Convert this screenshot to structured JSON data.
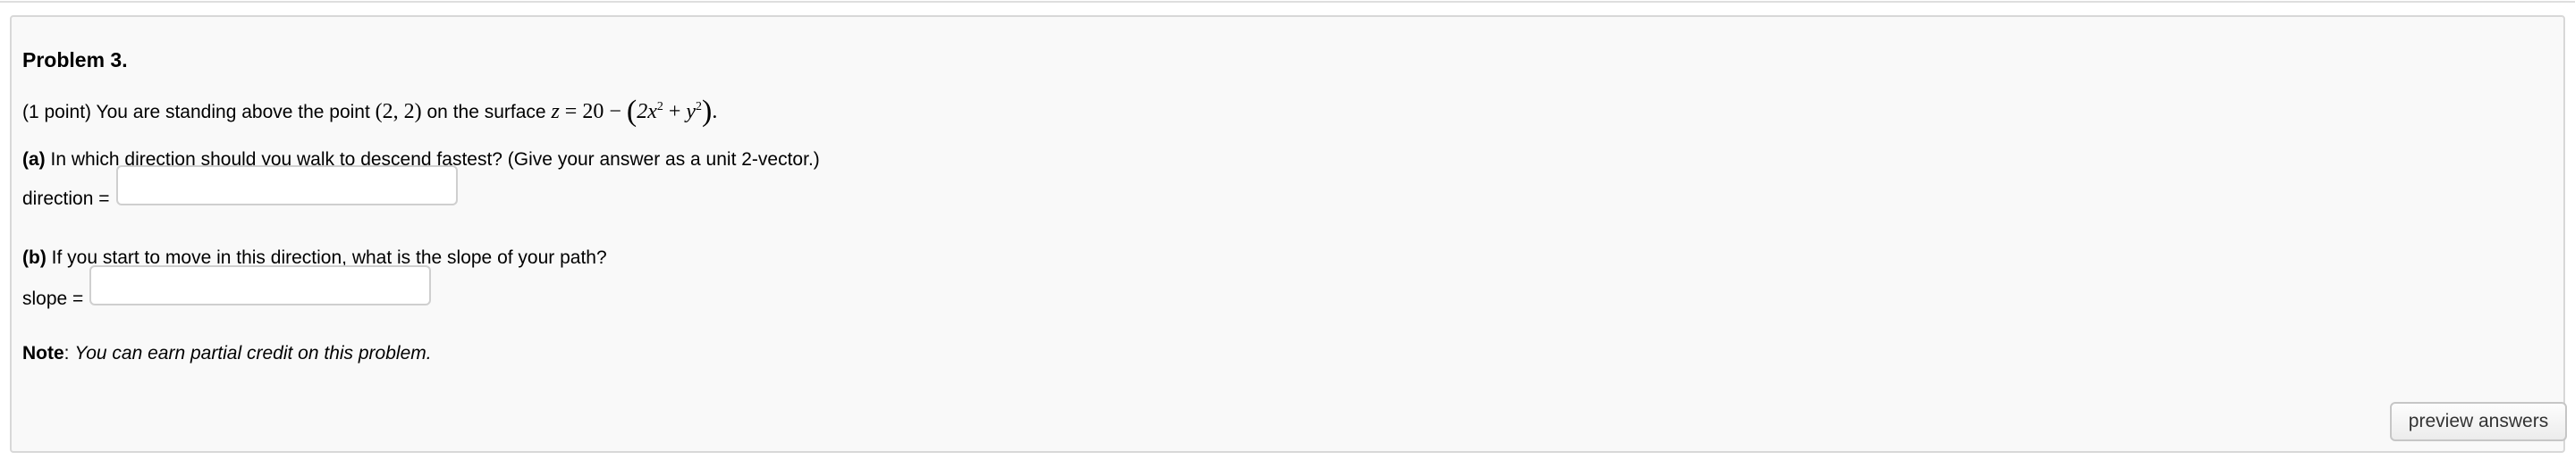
{
  "problem": {
    "title": "Problem 3.",
    "points": "(1 point)",
    "intro_before_point": "You are standing above the point",
    "point_math": "(2, 2)",
    "intro_after_point": "on the surface",
    "surface_lhs": "z",
    "surface_eq": "= 20 −",
    "surface_open": "(",
    "surface_term1": "2x",
    "surface_exp1": "2",
    "surface_plus": "+",
    "surface_term2": "y",
    "surface_exp2": "2",
    "surface_close": ")",
    "surface_end": "."
  },
  "part_a": {
    "label": "(a)",
    "question": "In which direction should you walk to descend fastest? (Give your answer as a unit 2-vector.)",
    "answer_label": "direction =",
    "answer_value": "",
    "answer_placeholder": ""
  },
  "part_b": {
    "label": "(b)",
    "question": "If you start to move in this direction, what is the slope of your path?",
    "answer_label": "slope =",
    "answer_value": "",
    "answer_placeholder": ""
  },
  "note": {
    "label": "Note",
    "colon": ":",
    "text": "You can earn partial credit on this problem."
  },
  "actions": {
    "preview_label": "preview answers"
  }
}
